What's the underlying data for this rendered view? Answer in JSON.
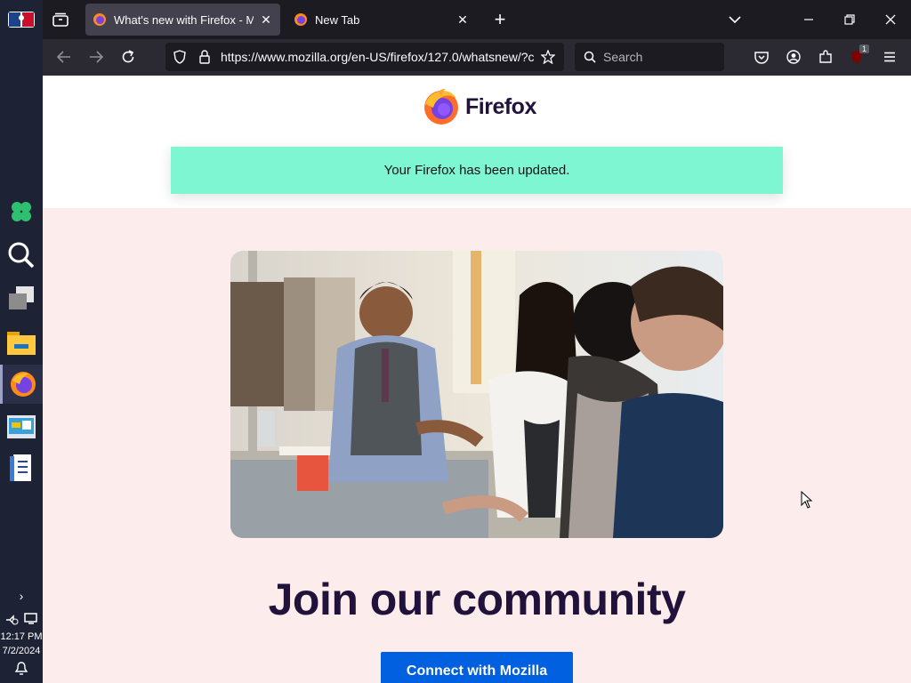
{
  "browser": {
    "tabs": [
      {
        "label": "What's new with Firefox - More",
        "active": true
      },
      {
        "label": "New Tab",
        "active": false
      }
    ],
    "url": "https://www.mozilla.org/en-US/firefox/127.0/whatsnew/?c",
    "search_placeholder": "Search",
    "extension_badge": "1"
  },
  "page": {
    "logo_text": "Firefox",
    "banner_text": "Your Firefox has been updated.",
    "heading": "Join our community",
    "cta_label": "Connect with Mozilla"
  },
  "taskbar": {
    "time": "12:17 PM",
    "date": "7/2/2024",
    "icons": [
      "nba-logo-icon",
      "clover-app-icon",
      "search-icon",
      "task-view-icon",
      "file-explorer-icon",
      "firefox-icon",
      "control-panel-icon",
      "notepad-icon"
    ]
  },
  "colors": {
    "banner": "#7ff6d2",
    "cta": "#0060df",
    "heading": "#20123a",
    "page_background": "#fdecec"
  }
}
